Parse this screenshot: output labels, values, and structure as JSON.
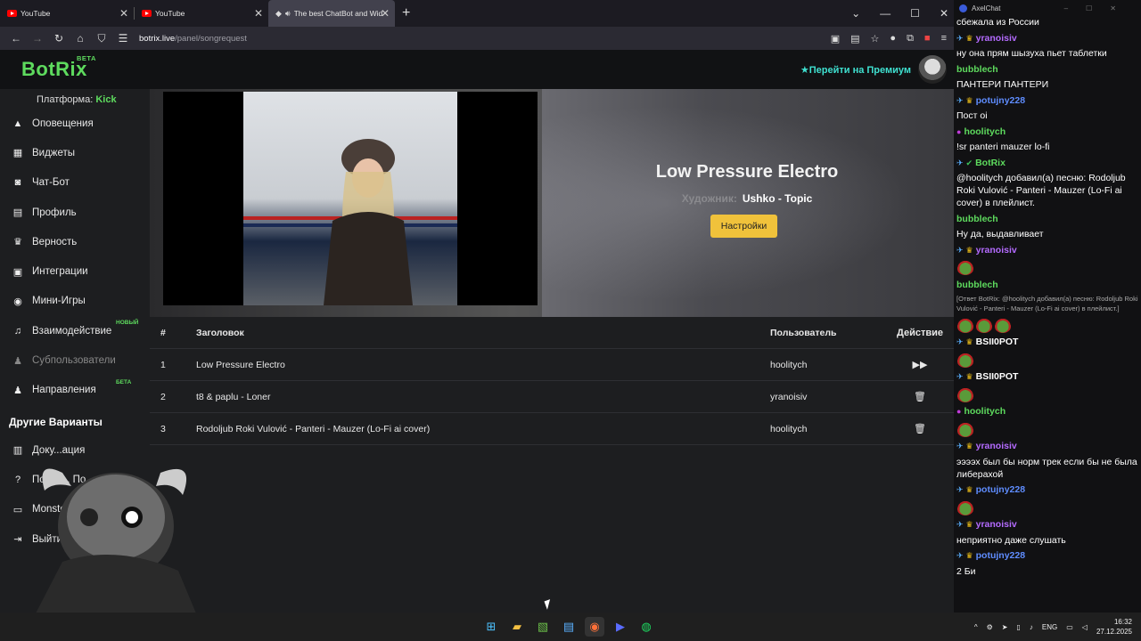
{
  "browser": {
    "tabs": [
      {
        "title": "YouTube",
        "icon": "youtube-icon"
      },
      {
        "title": "YouTube",
        "icon": "youtube-icon"
      },
      {
        "title": "The best ChatBot and Wid",
        "icon": "speaker-icon"
      }
    ],
    "url_host": "botrix.live",
    "url_path": "/panel/songrequest"
  },
  "app": {
    "logo": "BotRix",
    "logo_badge": "BETA",
    "premium_label": "Перейти на Премиум",
    "platform_label": "Платформа:",
    "platform_value": "Kick"
  },
  "sidebar": {
    "items": [
      {
        "label": "Оповещения",
        "icon": "warning-icon"
      },
      {
        "label": "Виджеты",
        "icon": "grid-icon"
      },
      {
        "label": "Чат-Бот",
        "icon": "robot-icon"
      },
      {
        "label": "Профиль",
        "icon": "id-card-icon"
      },
      {
        "label": "Верность",
        "icon": "trophy-icon"
      },
      {
        "label": "Интеграции",
        "icon": "plug-icon"
      },
      {
        "label": "Мини-Игры",
        "icon": "gamepad-icon"
      },
      {
        "label": "Взаимодействие",
        "icon": "music-icon",
        "badge": "НОВЫЙ"
      },
      {
        "label": "Субпользователи",
        "icon": "users-icon"
      },
      {
        "label": "Направления",
        "icon": "user-group-icon",
        "badge": "БЕТА"
      }
    ],
    "other_heading": "Другие Варианты",
    "other_items": [
      {
        "label": "Доку...ация",
        "icon": "book-icon"
      },
      {
        "label": "Получ... По...ку",
        "icon": "help-icon"
      },
      {
        "label": "Monsters",
        "icon": "monitor-icon"
      },
      {
        "label": "Выйти",
        "icon": "logout-icon"
      }
    ]
  },
  "player": {
    "title": "Low Pressure Electro",
    "artist_label": "Художник:",
    "artist": "Ushko - Topic",
    "settings_button": "Настройки"
  },
  "queue": {
    "headers": {
      "num": "#",
      "title": "Заголовок",
      "user": "Пользователь",
      "action": "Действие"
    },
    "rows": [
      {
        "num": "1",
        "title": "Low Pressure Electro",
        "user": "hoolitych",
        "action": "skip-icon"
      },
      {
        "num": "2",
        "title": "t8 & paplu - Loner",
        "user": "yranoisiv",
        "action": "trash-icon"
      },
      {
        "num": "3",
        "title": "Rodoljub Roki Vulović - Panteri - Mauzer (Lo-Fi ai cover)",
        "user": "hoolitych",
        "action": "trash-icon"
      }
    ]
  },
  "chat": {
    "window_title": "AxelChat",
    "messages": [
      {
        "text": "сбежала из России"
      },
      {
        "user": "yranoisiv",
        "color": "#b46bff",
        "badges": [
          "sword",
          "crown"
        ],
        "text": "ну она прям шызуха пьет таблетки"
      },
      {
        "user": "bubblech",
        "color": "#5edb5e",
        "badges": [],
        "text": "ПАНТЕРИ ПАНТЕРИ"
      },
      {
        "user": "potujny228",
        "color": "#5f8dff",
        "badges": [
          "sword",
          "crown"
        ],
        "text": "Пост оі"
      },
      {
        "user": "hoolitych",
        "color": "#5edb5e",
        "badges": [
          "mic"
        ],
        "text": "!sr panteri mauzer lo-fi"
      },
      {
        "user": "BotRix",
        "color": "#5edb5e",
        "badges": [
          "sword",
          "check"
        ],
        "text": "@hoolitych добавил(а) песню: Rodoljub Roki Vulović - Panteri - Mauzer (Lo-Fi ai cover) в плейлист."
      },
      {
        "user": "bubblech",
        "color": "#5edb5e",
        "badges": [],
        "text": "Ну да, выдавливает"
      },
      {
        "user": "yranoisiv",
        "color": "#b46bff",
        "badges": [
          "sword",
          "crown"
        ],
        "text": "",
        "emotes": 1
      },
      {
        "user": "bubblech",
        "color": "#5edb5e",
        "badges": [],
        "reply": "[Ответ BotRix: @hoolitych добавил(а) песню: Rodoljub Roki Vulović - Panteri - Mauzer (Lo-Fi ai cover) в плейлист.]",
        "emotes": 3
      },
      {
        "user": "BSII0POT",
        "color": "#fff",
        "badges": [
          "sword",
          "crown"
        ],
        "text": "",
        "emotes": 1
      },
      {
        "user": "BSII0POT",
        "color": "#fff",
        "badges": [
          "sword",
          "crown"
        ],
        "text": "",
        "emotes": 1
      },
      {
        "user": "hoolitych",
        "color": "#5edb5e",
        "badges": [
          "mic"
        ],
        "text": "",
        "emotes": 1
      },
      {
        "user": "yranoisiv",
        "color": "#b46bff",
        "badges": [
          "sword",
          "crown"
        ],
        "text": "ээээх был бы норм трек если бы не была либерахой"
      },
      {
        "user": "potujny228",
        "color": "#5f8dff",
        "badges": [
          "sword",
          "crown"
        ],
        "text": "",
        "emotes": 1
      },
      {
        "user": "yranoisiv",
        "color": "#b46bff",
        "badges": [
          "sword",
          "crown"
        ],
        "text": "неприятно даже слушать"
      },
      {
        "user": "potujny228",
        "color": "#5f8dff",
        "badges": [
          "sword",
          "crown"
        ],
        "text": "2 Би"
      }
    ]
  },
  "taskbar": {
    "lang": "ENG",
    "time": "16:32",
    "date": "27.12.2025"
  }
}
